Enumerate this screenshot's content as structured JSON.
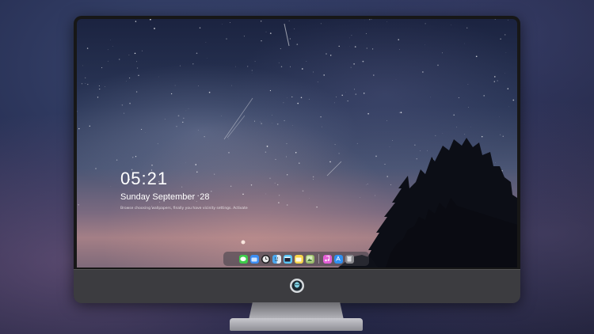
{
  "lock_screen": {
    "time": "05:21",
    "date": "Sunday September  28",
    "hint": "Browse choosing wallpapers, finally you have vicinity settings. Activate"
  },
  "dock": {
    "items": [
      {
        "name": "messages",
        "icon": "speech-bubble",
        "color": "#3ecb4a"
      },
      {
        "name": "files",
        "icon": "folder",
        "color": "#3b8df3"
      },
      {
        "name": "clock",
        "icon": "clock-face",
        "color": "#e9e9e9"
      },
      {
        "name": "finder",
        "icon": "finder-face",
        "color": "#d9d9d9"
      },
      {
        "name": "video",
        "icon": "clapper",
        "color": "#5ac8fa"
      },
      {
        "name": "notes",
        "icon": "notepad",
        "color": "#f7d44a"
      },
      {
        "name": "photos",
        "icon": "photo-frame",
        "color": "#9bbd6a"
      },
      {
        "name": "music",
        "icon": "music-note",
        "color": "#e45fd6"
      },
      {
        "name": "app-store",
        "icon": "app-store",
        "color": "#2f8ff0"
      },
      {
        "name": "trash",
        "icon": "trash-can",
        "color": "#8a8a8e"
      }
    ]
  },
  "colors": {
    "bezel": "#171717",
    "chin": "#3c3c40",
    "lock_text": "#ffffff"
  }
}
